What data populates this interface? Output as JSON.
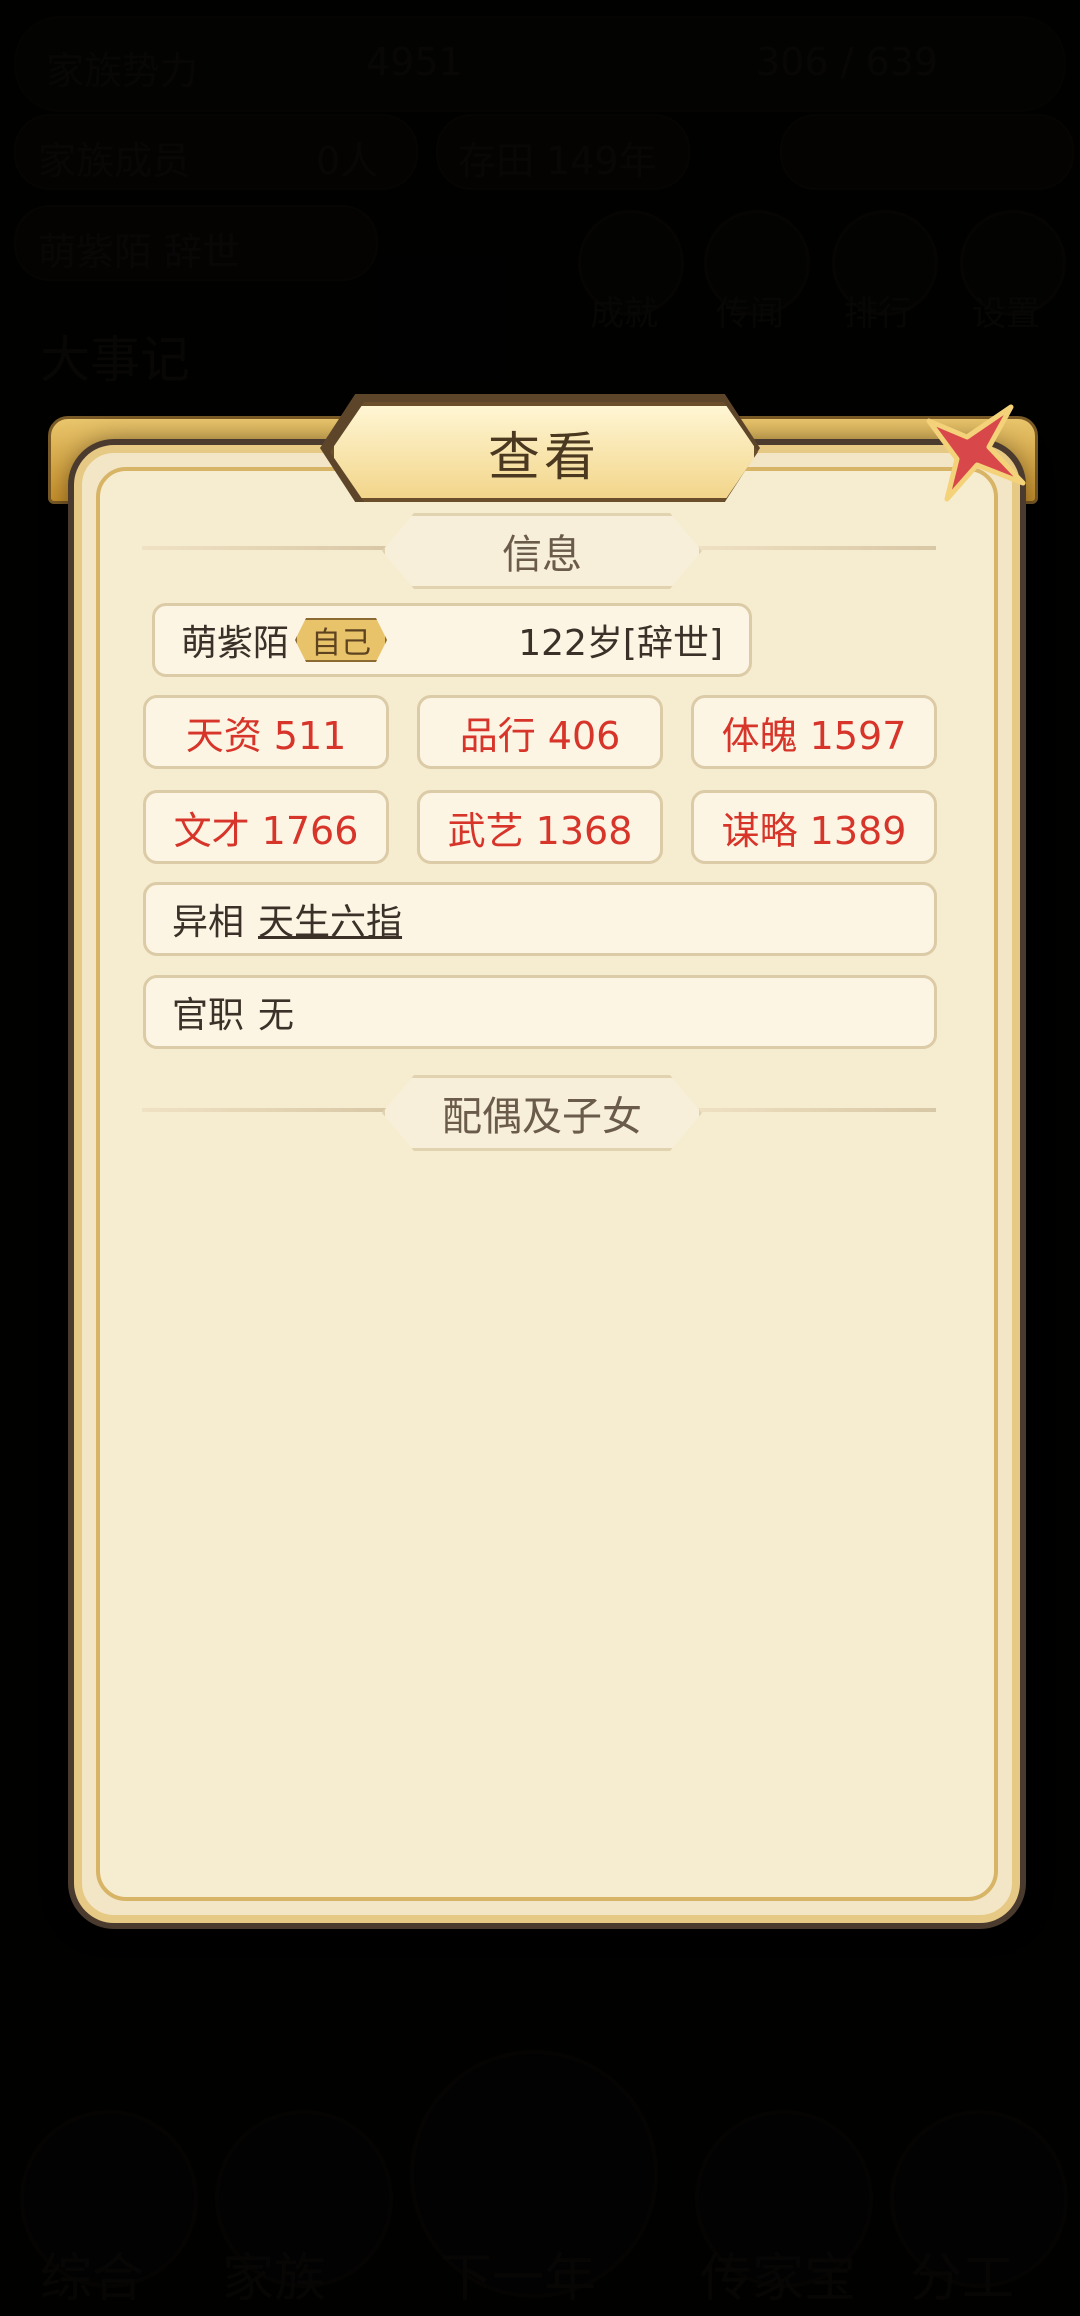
{
  "background": {
    "row1": {
      "left": "家族势力",
      "mid": "4951",
      "right": "306 / 639"
    },
    "row2": {
      "left": "家族成员",
      "mid": "0人",
      "center": "存田 149年"
    },
    "row3": {
      "left": "萌紫陌 辞世"
    },
    "icons": [
      "成就",
      "传闻",
      "排行",
      "设置"
    ],
    "event_title": "大事记",
    "bottom_nav": [
      "综合",
      "家族",
      "下一年",
      "传家宝",
      "分工"
    ]
  },
  "dialog": {
    "title": "查看",
    "info_header": "信息",
    "person": {
      "name": "萌紫陌",
      "tag": "自己",
      "age_status": "122岁[辞世]"
    },
    "stats": [
      {
        "label": "天资 511"
      },
      {
        "label": "品行 406"
      },
      {
        "label": "体魄 1597"
      },
      {
        "label": "文才 1766"
      },
      {
        "label": "武艺 1368"
      },
      {
        "label": "谋略 1389"
      }
    ],
    "trait": {
      "label": "异相",
      "value": "天生六指"
    },
    "office": {
      "label": "官职",
      "value": "无"
    },
    "family_header": "配偶及子女"
  },
  "colors": {
    "stat_red": "#d7342a",
    "panel_bg": "#f6ecd0",
    "gold": "#e7c986"
  }
}
